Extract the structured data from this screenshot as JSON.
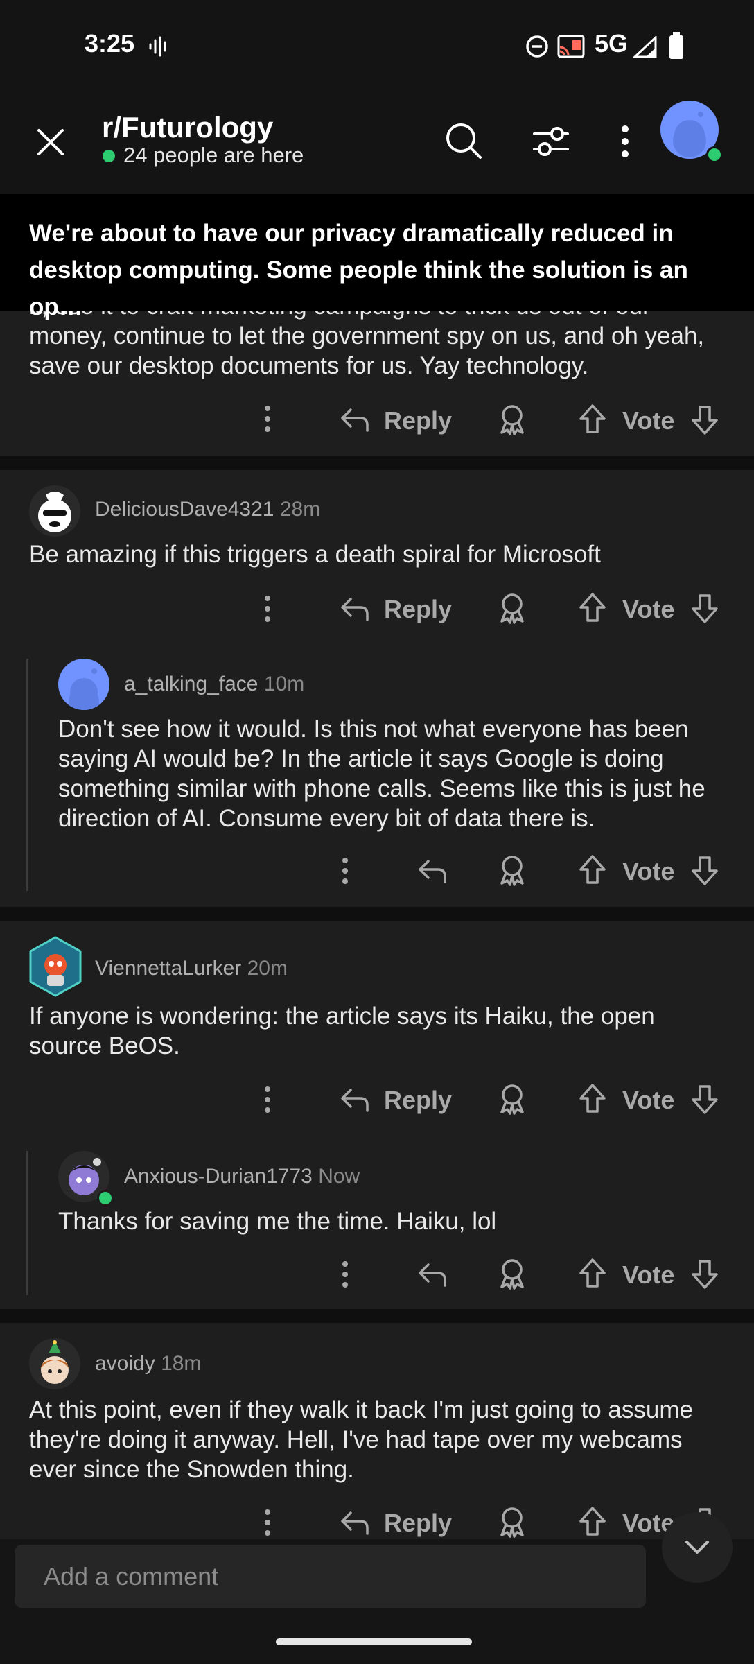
{
  "status_bar": {
    "time": "3:25",
    "network": "5G",
    "icons": [
      "voice-waveform-icon",
      "do-not-disturb-icon",
      "cast-icon",
      "signal-icon",
      "battery-icon"
    ]
  },
  "header": {
    "subreddit": "r/Futurology",
    "presence": "24 people are here",
    "icons": [
      "close-icon",
      "search-icon",
      "filter-icon",
      "more-vertical-icon",
      "avatar"
    ]
  },
  "post": {
    "title": "We're about to have our privacy dramatically reduced in desktop computing. Some people think the solution is an op…"
  },
  "actions": {
    "reply": "Reply",
    "vote": "Vote"
  },
  "comments": [
    {
      "author": "",
      "time": "",
      "body": "it, use it to craft marketing campaigns to trick us out of our money, continue to let the government spy on us, and oh yeah, save our desktop documents for us. Yay technology."
    },
    {
      "author": "DeliciousDave4321",
      "time": "28m",
      "body": "Be amazing if this triggers a death spiral for Microsoft"
    },
    {
      "author": "a_talking_face",
      "time": "10m",
      "body": "Don't see how it would. Is this not what everyone has been saying AI would be? In the article it says Google is doing something similar with phone calls. Seems like this is just he direction of AI. Consume every bit of data there is."
    },
    {
      "author": "ViennettaLurker",
      "time": "20m",
      "body": "If anyone is wondering: the article says its Haiku, the open source BeOS."
    },
    {
      "author": "Anxious-Durian1773",
      "time": "Now",
      "body": "Thanks for saving me the time. Haiku, lol"
    },
    {
      "author": "avoidy",
      "time": "18m",
      "body": "At this point, even if they walk it back I'm just going to assume they're doing it anyway. Hell, I've had tape over my webcams ever since the Snowden thing."
    }
  ],
  "composer": {
    "placeholder": "Add a comment"
  },
  "colors": {
    "background": "#151515",
    "card": "#1e1e1e",
    "presence_green": "#2ecc71",
    "snoo_blue": "#7193ff"
  }
}
